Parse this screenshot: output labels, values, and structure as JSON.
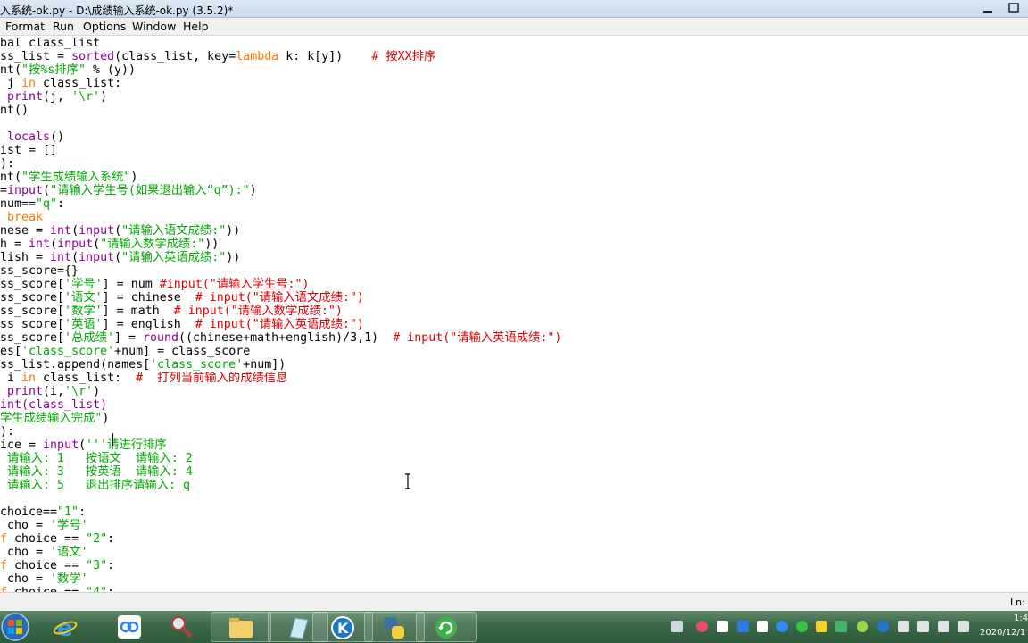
{
  "window": {
    "title": "入系统-ok.py - D:\\成绩输入系统-ok.py (3.5.2)*"
  },
  "menu": [
    "Format",
    "Run",
    "Options",
    "Window",
    "Help"
  ],
  "editor": {
    "lines": [
      [
        [
          "bal class_list",
          ""
        ]
      ],
      [
        [
          "ss_list = ",
          ""
        ],
        [
          "sorted",
          "bi"
        ],
        [
          "(class_list, key=",
          ""
        ],
        [
          "lambda",
          "kw"
        ],
        [
          " k: k[y])    ",
          ""
        ],
        [
          "# 按XX排序",
          "cm"
        ]
      ],
      [
        [
          "nt(",
          ""
        ],
        [
          "\"按%s排序\"",
          "str"
        ],
        [
          " % (y))",
          ""
        ]
      ],
      [
        [
          " j ",
          ""
        ],
        [
          "in",
          "kw"
        ],
        [
          " class_list:",
          ""
        ]
      ],
      [
        [
          " ",
          ""
        ],
        [
          "print",
          "bi"
        ],
        [
          "(j, ",
          ""
        ],
        [
          "'\\r'",
          "str"
        ],
        [
          ")",
          ""
        ]
      ],
      [
        [
          "nt()",
          ""
        ]
      ],
      [
        [
          "",
          ""
        ]
      ],
      [
        [
          " ",
          ""
        ],
        [
          "locals",
          "bi"
        ],
        [
          "()",
          ""
        ]
      ],
      [
        [
          "ist = []",
          ""
        ]
      ],
      [
        [
          "):",
          ""
        ]
      ],
      [
        [
          "nt(",
          ""
        ],
        [
          "\"学生成绩输入系统\"",
          "str"
        ],
        [
          ")",
          ""
        ]
      ],
      [
        [
          "=",
          ""
        ],
        [
          "input",
          "bi"
        ],
        [
          "(",
          ""
        ],
        [
          "\"请输入学生号(如果退出输入“q”):\"",
          "str"
        ],
        [
          ")",
          ""
        ]
      ],
      [
        [
          "num==",
          ""
        ],
        [
          "\"q\"",
          "str"
        ],
        [
          ":",
          ""
        ]
      ],
      [
        [
          " ",
          ""
        ],
        [
          "break",
          "kw"
        ]
      ],
      [
        [
          "nese = ",
          ""
        ],
        [
          "int",
          "bi"
        ],
        [
          "(",
          ""
        ],
        [
          "input",
          "bi"
        ],
        [
          "(",
          ""
        ],
        [
          "\"请输入语文成绩:\"",
          "str"
        ],
        [
          "))",
          ""
        ]
      ],
      [
        [
          "h = ",
          ""
        ],
        [
          "int",
          "bi"
        ],
        [
          "(",
          ""
        ],
        [
          "input",
          "bi"
        ],
        [
          "(",
          ""
        ],
        [
          "\"请输入数学成绩:\"",
          "str"
        ],
        [
          "))",
          ""
        ]
      ],
      [
        [
          "lish = ",
          ""
        ],
        [
          "int",
          "bi"
        ],
        [
          "(",
          ""
        ],
        [
          "input",
          "bi"
        ],
        [
          "(",
          ""
        ],
        [
          "\"请输入英语成绩:\"",
          "str"
        ],
        [
          "))",
          ""
        ]
      ],
      [
        [
          "ss_score={}",
          ""
        ]
      ],
      [
        [
          "ss_score[",
          ""
        ],
        [
          "'学号'",
          "str"
        ],
        [
          "] = num ",
          ""
        ],
        [
          "#input(\"请输入学生号:\")",
          "cm"
        ]
      ],
      [
        [
          "ss_score[",
          ""
        ],
        [
          "'语文'",
          "str"
        ],
        [
          "] = chinese  ",
          ""
        ],
        [
          "# input(\"请输入语文成绩:\")",
          "cm"
        ]
      ],
      [
        [
          "ss_score[",
          ""
        ],
        [
          "'数学'",
          "str"
        ],
        [
          "] = math  ",
          ""
        ],
        [
          "# input(\"请输入数学成绩:\")",
          "cm"
        ]
      ],
      [
        [
          "ss_score[",
          ""
        ],
        [
          "'英语'",
          "str"
        ],
        [
          "] = english  ",
          ""
        ],
        [
          "# input(\"请输入英语成绩:\")",
          "cm"
        ]
      ],
      [
        [
          "ss_score[",
          ""
        ],
        [
          "'总成绩'",
          "str"
        ],
        [
          "] = ",
          ""
        ],
        [
          "round",
          "bi"
        ],
        [
          "((chinese+math+english)/3,1)  ",
          ""
        ],
        [
          "# input(\"请输入英语成绩:\")",
          "cm"
        ]
      ],
      [
        [
          "es[",
          ""
        ],
        [
          "'class_score'",
          "str"
        ],
        [
          "+num] = class_score",
          ""
        ]
      ],
      [
        [
          "ss_list.append(names[",
          ""
        ],
        [
          "'class_score'",
          "str"
        ],
        [
          "+num])",
          ""
        ]
      ],
      [
        [
          " i ",
          ""
        ],
        [
          "in",
          "kw"
        ],
        [
          " class_list:  ",
          ""
        ],
        [
          "#  打列当前输入的成绩信息",
          "cm"
        ]
      ],
      [
        [
          " ",
          ""
        ],
        [
          "print",
          "bi"
        ],
        [
          "(i,",
          ""
        ],
        [
          "'\\r'",
          "str"
        ],
        [
          ")",
          ""
        ]
      ],
      [
        [
          "int(class_list)",
          "bi"
        ]
      ],
      [
        [
          "学生成绩输入完成\"",
          "str"
        ],
        [
          ")",
          ""
        ]
      ],
      [
        [
          "):",
          ""
        ]
      ],
      [
        [
          "ice = ",
          ""
        ],
        [
          "input",
          "bi"
        ],
        [
          "(",
          ""
        ],
        [
          "'''请进行排序",
          "str"
        ]
      ],
      [
        [
          " 请输入: 1   按语文  请输入: 2",
          "str"
        ]
      ],
      [
        [
          " 请输入: 3   按英语  请输入: 4",
          "str"
        ]
      ],
      [
        [
          " 请输入: 5   退出排序请输入: q",
          "str"
        ]
      ],
      [
        [
          "",
          ""
        ]
      ],
      [
        [
          "choice==",
          ""
        ],
        [
          "\"1\"",
          "str"
        ],
        [
          ":",
          ""
        ]
      ],
      [
        [
          " cho = ",
          ""
        ],
        [
          "'学号'",
          "str"
        ]
      ],
      [
        [
          "f",
          "kw"
        ],
        [
          " choice == ",
          ""
        ],
        [
          "\"2\"",
          "str"
        ],
        [
          ":",
          ""
        ]
      ],
      [
        [
          " cho = ",
          ""
        ],
        [
          "'语文'",
          "str"
        ]
      ],
      [
        [
          "f",
          "kw"
        ],
        [
          " choice == ",
          ""
        ],
        [
          "\"3\"",
          "str"
        ],
        [
          ":",
          ""
        ]
      ],
      [
        [
          " cho = ",
          ""
        ],
        [
          "'数学'",
          "str"
        ]
      ],
      [
        [
          "f",
          "kw"
        ],
        [
          " choice == ",
          ""
        ],
        [
          "\"4\"",
          "str"
        ],
        [
          ":",
          ""
        ]
      ]
    ]
  },
  "status": {
    "ln": "Ln:"
  },
  "taskbar": {
    "apps": [
      "windows-start",
      "internet-explorer",
      "cloud-app",
      "tools-app",
      "file-explorer",
      "notes-app",
      "k-app",
      "python-idle",
      "refresh-app"
    ],
    "clock_time": "1:4",
    "clock_date": "2020/12/1"
  },
  "colors": {
    "keyword": "#ff7700",
    "builtin": "#900090",
    "string": "#00aa00",
    "comment": "#dd0000"
  }
}
